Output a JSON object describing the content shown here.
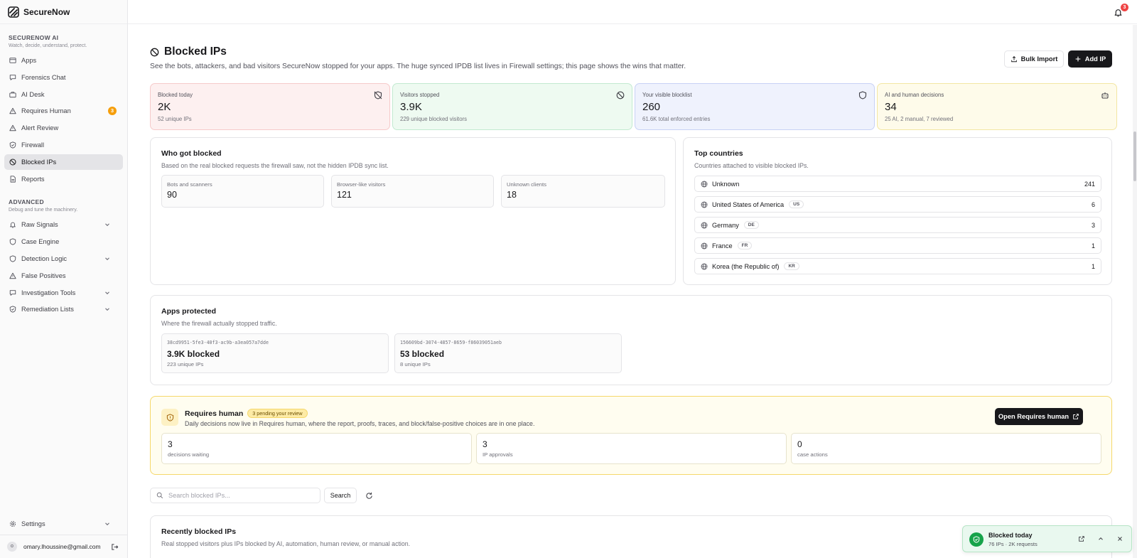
{
  "brand": {
    "name": "SecureNow"
  },
  "sidebar": {
    "section1": {
      "heading": "SECURENOW AI",
      "sub": "Watch, decide, understand, protect."
    },
    "items1": [
      {
        "label": "Apps",
        "icon": "window-icon"
      },
      {
        "label": "Forensics Chat",
        "icon": "chat-icon"
      },
      {
        "label": "AI Desk",
        "icon": "briefcase-icon"
      },
      {
        "label": "Requires Human",
        "icon": "warning-icon",
        "badge": "3"
      },
      {
        "label": "Alert Review",
        "icon": "warning-icon"
      },
      {
        "label": "Firewall",
        "icon": "shield-check-icon"
      },
      {
        "label": "Blocked IPs",
        "icon": "ban-icon",
        "active": true
      },
      {
        "label": "Reports",
        "icon": "file-icon"
      }
    ],
    "section2": {
      "heading": "ADVANCED",
      "sub": "Debug and tune the machinery."
    },
    "items2": [
      {
        "label": "Raw Signals",
        "icon": "bell-icon",
        "expandable": true
      },
      {
        "label": "Case Engine",
        "icon": "shield-icon"
      },
      {
        "label": "Detection Logic",
        "icon": "shield-icon",
        "expandable": true
      },
      {
        "label": "False Positives",
        "icon": "warning-icon"
      },
      {
        "label": "Investigation Tools",
        "icon": "chat-icon",
        "expandable": true
      },
      {
        "label": "Remediation Lists",
        "icon": "shield-check-icon",
        "expandable": true
      }
    ],
    "settings": "Settings",
    "user": {
      "initial": "o",
      "email": "omary.lhoussine@gmail.com"
    }
  },
  "topbar": {
    "notifications": "3"
  },
  "page": {
    "title": "Blocked IPs",
    "description": "See the bots, attackers, and bad visitors SecureNow stopped for your apps. The huge synced IPDB list lives in Firewall settings; this page shows the wins that matter.",
    "bulk_import": "Bulk Import",
    "add_ip": "Add IP"
  },
  "stats": [
    {
      "label": "Blocked today",
      "value": "2K",
      "sub": "52 unique IPs",
      "bg": "#fdf0f0",
      "border": "#f6caca",
      "icon": "shield-off-icon"
    },
    {
      "label": "Visitors stopped",
      "value": "3.9K",
      "sub": "229 unique blocked visitors",
      "bg": "#eefaf1",
      "border": "#c2ead0",
      "icon": "ban-icon"
    },
    {
      "label": "Your visible blocklist",
      "value": "260",
      "sub": "61.6K total enforced entries",
      "bg": "#eff2fd",
      "border": "#c8d2f5",
      "icon": "shield-icon"
    },
    {
      "label": "AI and human decisions",
      "value": "34",
      "sub": "25 AI, 2 manual, 7 reviewed",
      "bg": "#fefbea",
      "border": "#f3e6a3",
      "icon": "bot-icon"
    }
  ],
  "who_blocked": {
    "title": "Who got blocked",
    "sub": "Based on the real blocked requests the firewall saw, not the hidden IPDB sync list.",
    "items": [
      {
        "label": "Bots and scanners",
        "value": "90"
      },
      {
        "label": "Browser-like visitors",
        "value": "121"
      },
      {
        "label": "Unknown clients",
        "value": "18"
      }
    ]
  },
  "top_countries": {
    "title": "Top countries",
    "sub": "Countries attached to visible blocked IPs.",
    "items": [
      {
        "name": "Unknown",
        "code": "",
        "count": "241"
      },
      {
        "name": "United States of America",
        "code": "US",
        "count": "6"
      },
      {
        "name": "Germany",
        "code": "DE",
        "count": "3"
      },
      {
        "name": "France",
        "code": "FR",
        "count": "1"
      },
      {
        "name": "Korea (the Republic of)",
        "code": "KR",
        "count": "1"
      }
    ]
  },
  "apps_protected": {
    "title": "Apps protected",
    "sub": "Where the firewall actually stopped traffic.",
    "items": [
      {
        "id": "38cd9951-5fe3-40f3-ac9b-a3ea057a7dde",
        "value": "3.9K blocked",
        "sub": "223 unique IPs"
      },
      {
        "id": "156609bd-3074-4857-8659-f86039051aeb",
        "value": "53 blocked",
        "sub": "8 unique IPs"
      }
    ]
  },
  "requires_human": {
    "title": "Requires human",
    "pill": "3 pending your review",
    "sub": "Daily decisions now live in Requires human, where the report, proofs, traces, and block/false-positive choices are in one place.",
    "button": "Open Requires human",
    "items": [
      {
        "value": "3",
        "label": "decisions waiting"
      },
      {
        "value": "3",
        "label": "IP approvals"
      },
      {
        "value": "0",
        "label": "case actions"
      }
    ]
  },
  "search": {
    "placeholder": "Search blocked IPs...",
    "button": "Search"
  },
  "recent": {
    "title": "Recently blocked IPs",
    "sub": "Real stopped visitors plus IPs blocked by AI, automation, human review, or manual action."
  },
  "toast": {
    "title": "Blocked today",
    "sub": "76 IPs · 2K requests"
  }
}
